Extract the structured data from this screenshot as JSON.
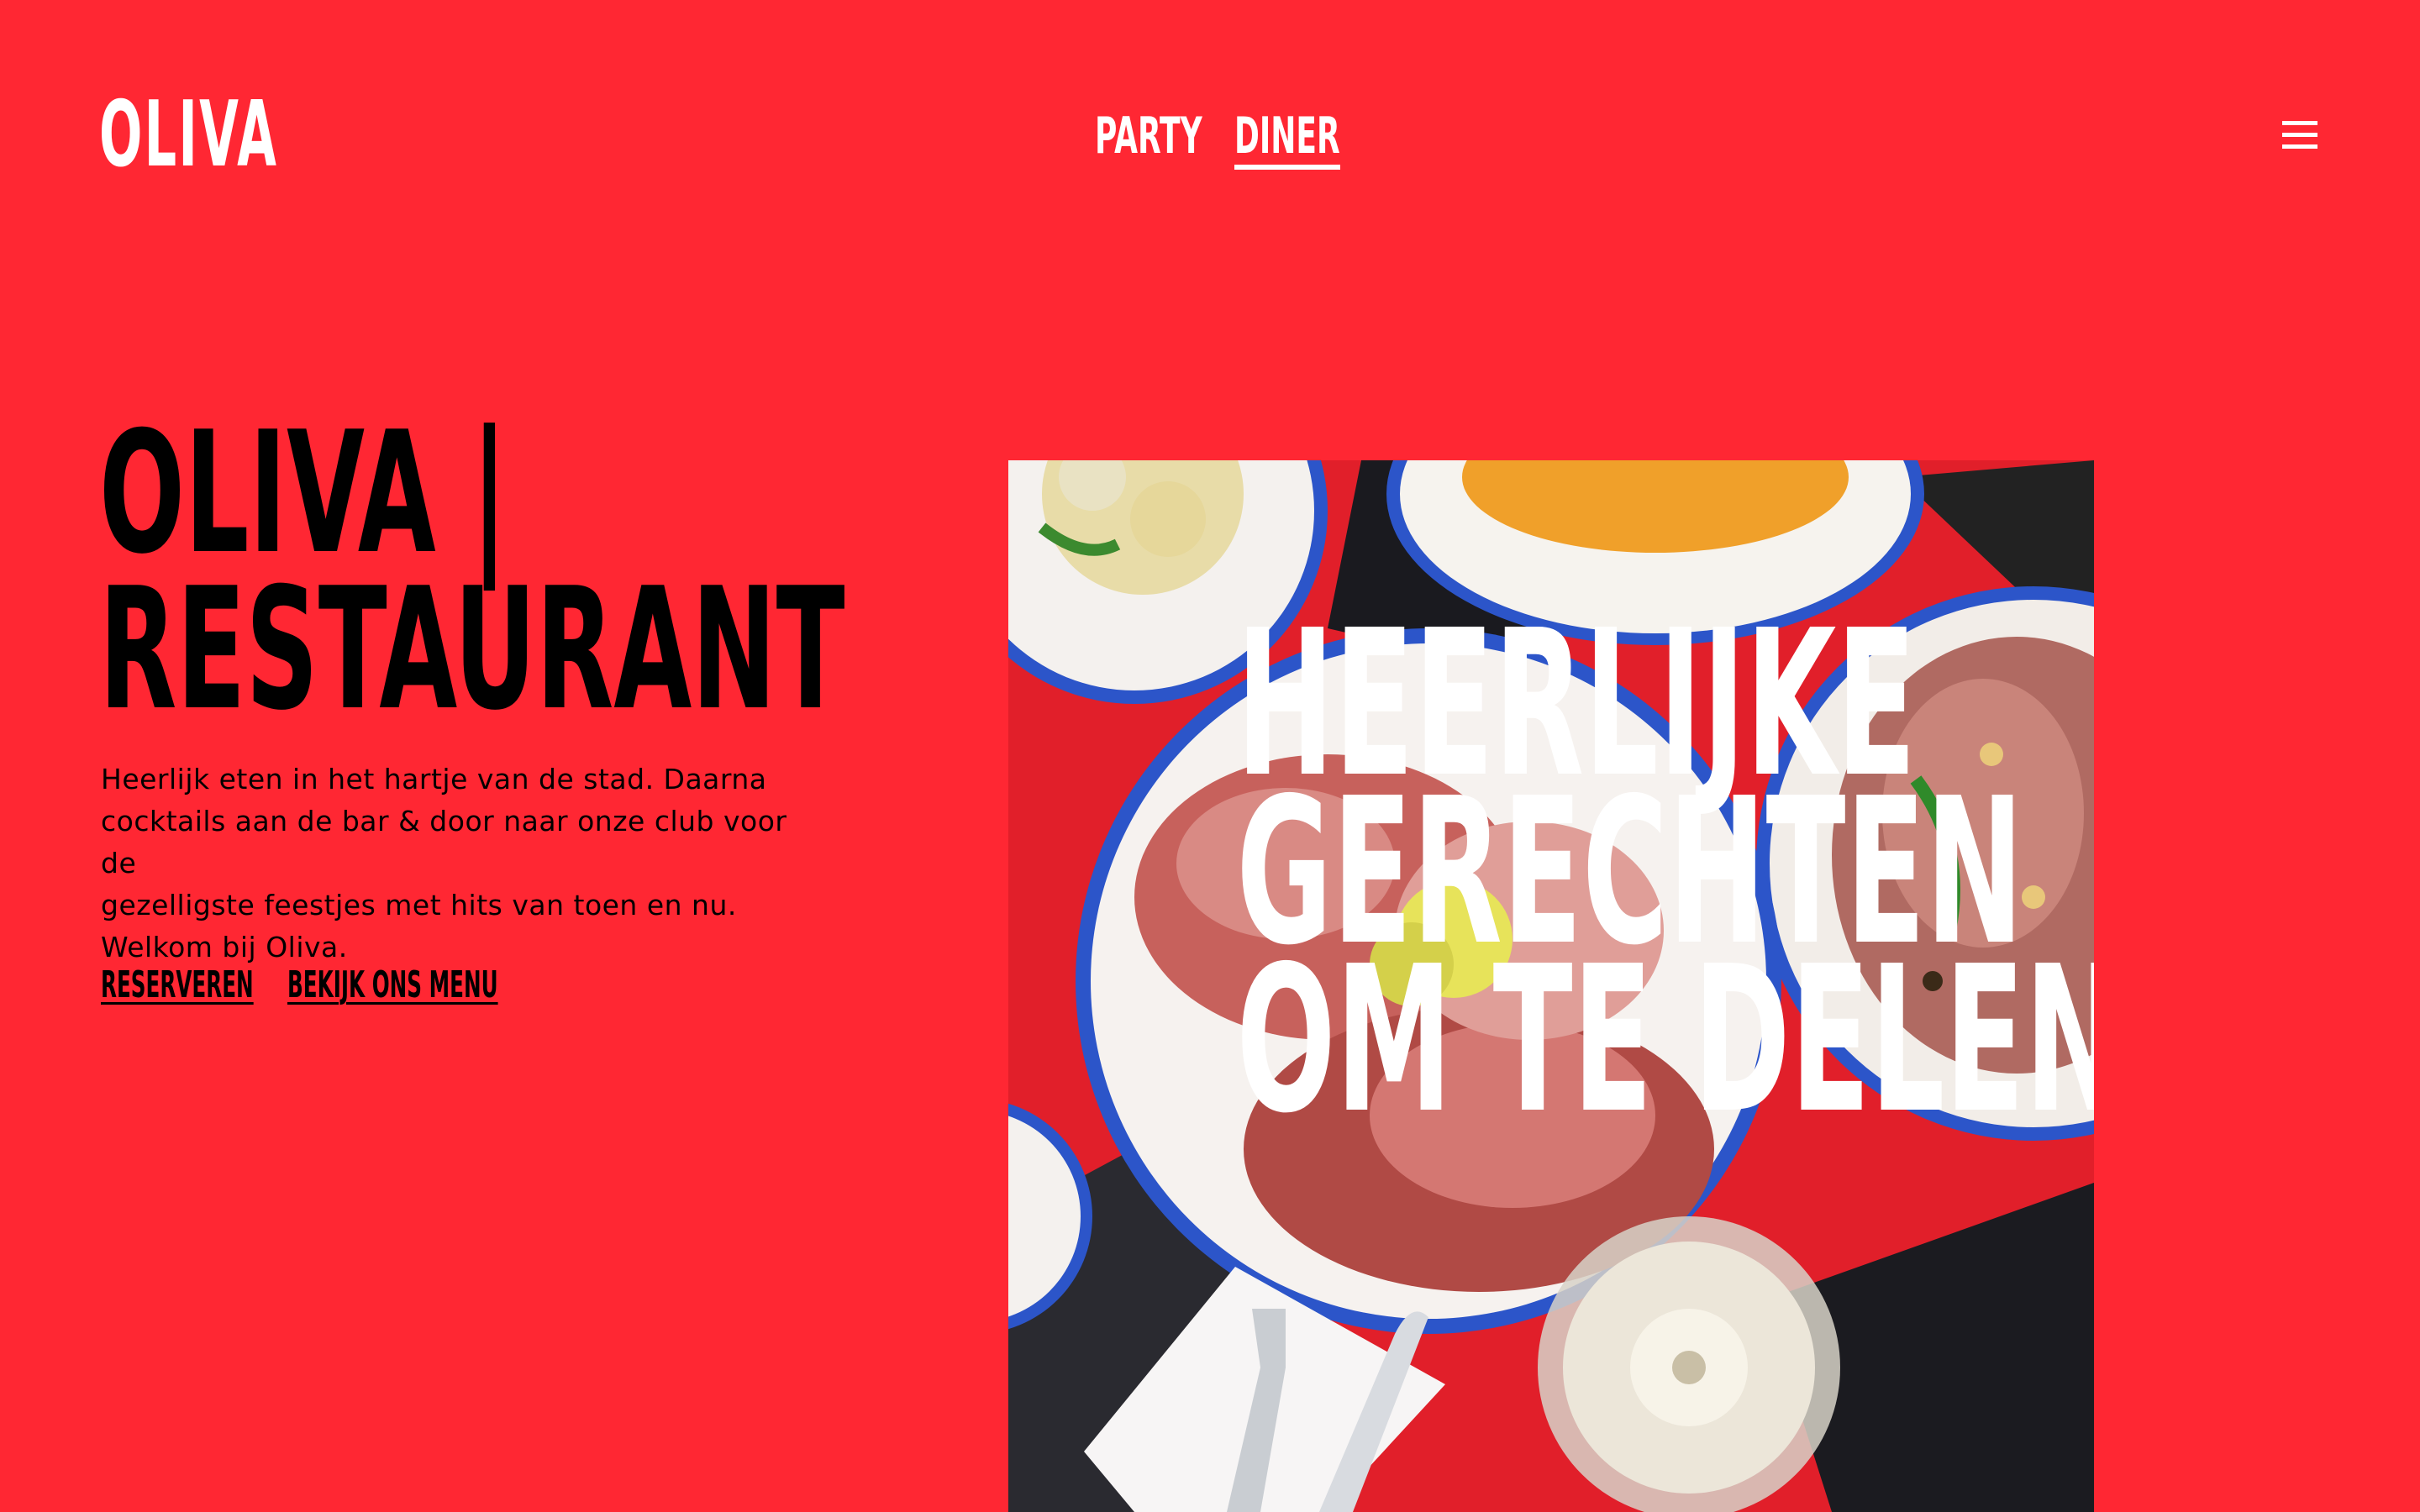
{
  "header": {
    "logo": "OLIVA",
    "nav": [
      {
        "label": "PARTY",
        "active": false
      },
      {
        "label": "DINER",
        "active": true
      }
    ],
    "menu_icon": "hamburger-menu-icon"
  },
  "hero": {
    "title_line1": "OLIVA |",
    "title_line2": "RESTAURANT",
    "description_line1": "Heerlijk eten in het hartje van de stad. Daarna",
    "description_line2": "cocktails aan de bar & door naar onze club voor de",
    "description_line3": "gezelligste feestjes met hits van toen en nu.",
    "description_line4": "Welkom bij Oliva.",
    "link_reserve": "RESERVEREN",
    "link_menu": "BEKIJK ONS MENU"
  },
  "feature": {
    "headline_line1": "HEERLIJKE",
    "headline_line2": "GERECHTEN",
    "headline_line3": "OM TE DELEN"
  },
  "colors": {
    "background": "#ff2733",
    "text_light": "#ffffff",
    "text_dark": "#000000",
    "plate_rim": "#2c55c9"
  }
}
